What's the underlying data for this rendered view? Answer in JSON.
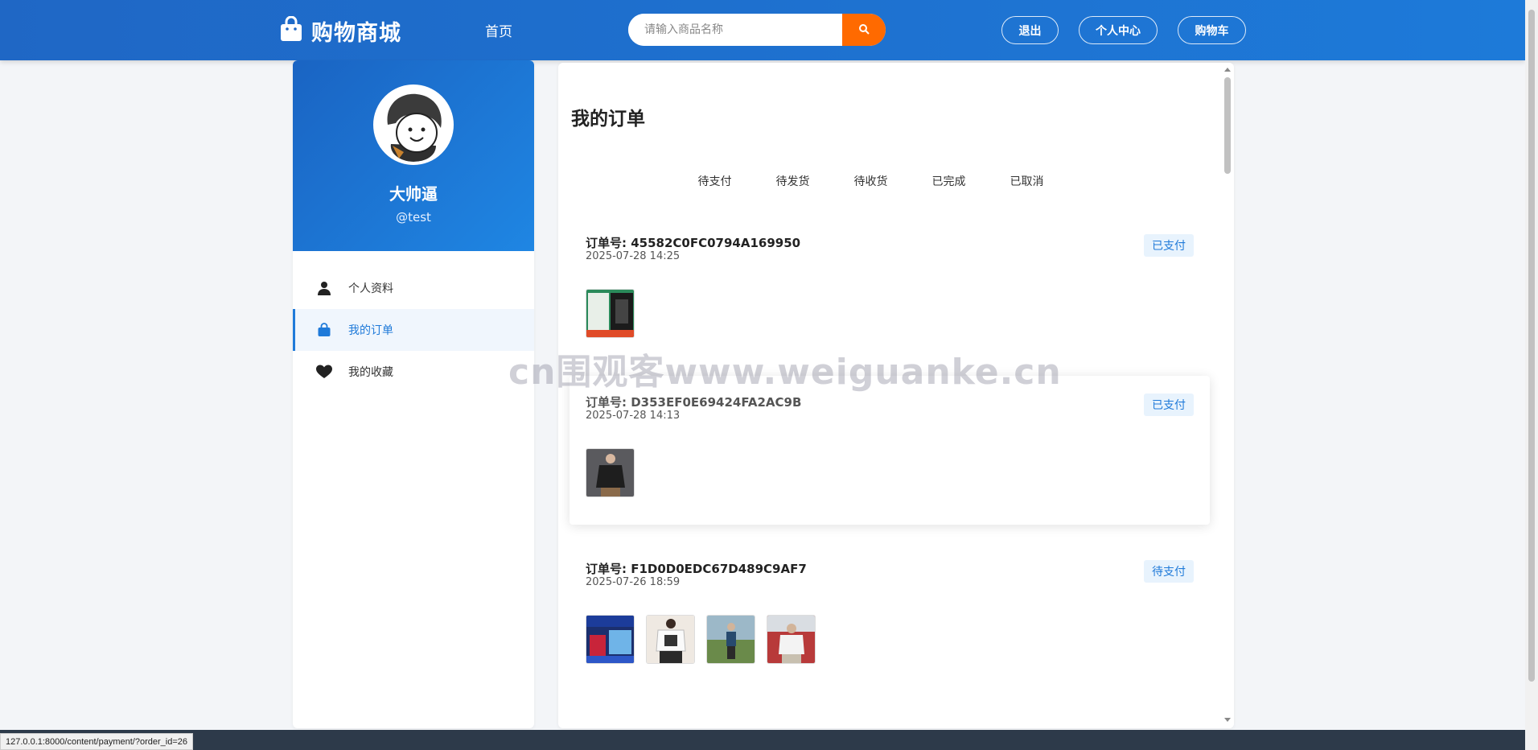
{
  "header": {
    "logo_text": "购物商城",
    "nav_home": "首页",
    "search_placeholder": "请输入商品名称",
    "logout": "退出",
    "profile": "个人中心",
    "cart": "购物车"
  },
  "sidebar": {
    "username": "大帅逼",
    "handle": "@test",
    "items": [
      {
        "label": "个人资料",
        "icon": "user-icon"
      },
      {
        "label": "我的订单",
        "icon": "shopping-bag-icon"
      },
      {
        "label": "我的收藏",
        "icon": "heart-icon"
      }
    ]
  },
  "main": {
    "title": "我的订单",
    "tabs": [
      "待支付",
      "待发货",
      "待收货",
      "已完成",
      "已取消"
    ],
    "orders": [
      {
        "order_no": "订单号: 45582C0FC0794A169950",
        "time": "2025-07-28 14:25",
        "status": "已支付"
      },
      {
        "order_no": "订单号: D353EF0E69424FA2AC9B",
        "time": "2025-07-28 14:13",
        "status": "已支付"
      },
      {
        "order_no": "订单号: F1D0D0EDC67D489C9AF7",
        "time": "2025-07-26 18:59",
        "status": "待支付"
      }
    ]
  },
  "status_bar": {
    "url": "127.0.0.1:8000/content/payment/?order_id=26"
  },
  "watermark": "cn围观客www.weiguanke.cn",
  "colors": {
    "header_blue": "#1f67c5",
    "accent_orange": "#ff6a00",
    "accent_blue": "#1f7ad9"
  }
}
